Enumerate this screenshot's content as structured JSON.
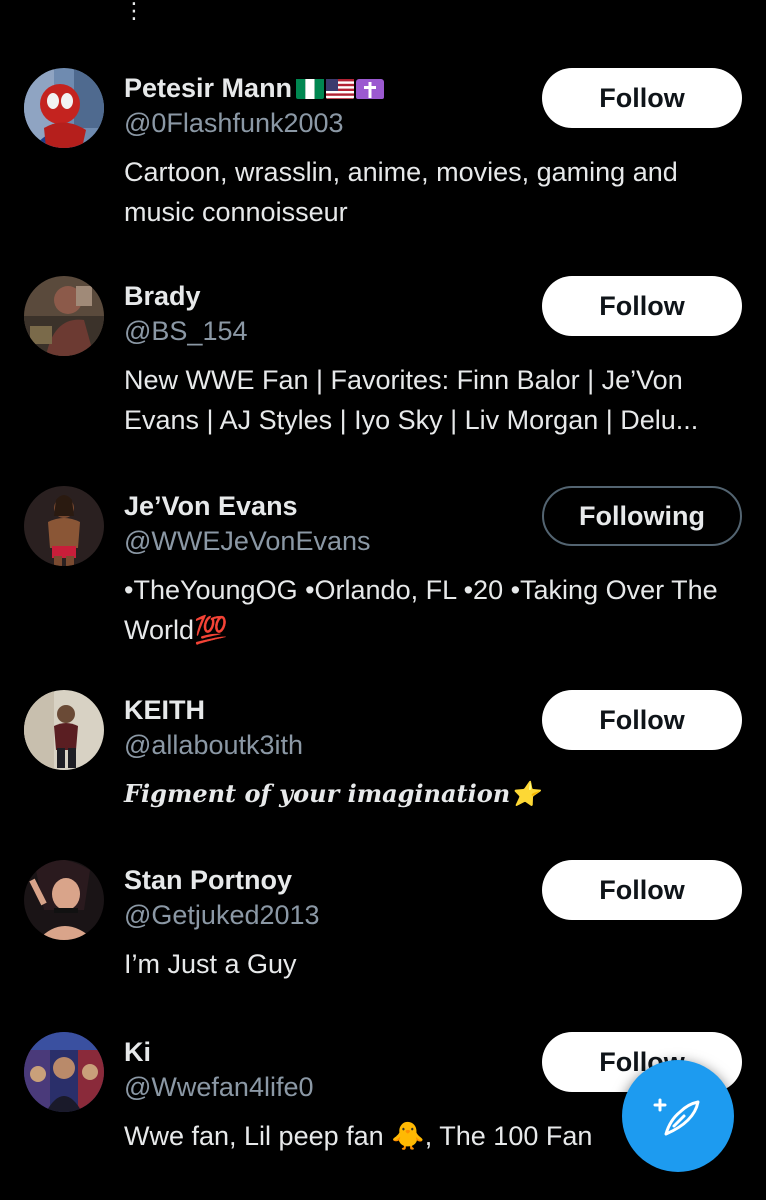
{
  "top_indicator": "⋮",
  "colors": {
    "background": "#000000",
    "primary_text": "#e7e9ea",
    "secondary_text": "#8b98a5",
    "accent": "#1d9bf0",
    "follow_bg": "#ffffff"
  },
  "users": [
    {
      "name": "Petesir Mann",
      "badges": [
        "🇳🇬",
        "🇺🇸",
        "✝️"
      ],
      "handle": "@0Flashfunk2003",
      "bio": "Cartoon, wrasslin, anime, movies, gaming and music connoisseur",
      "button": "Follow"
    },
    {
      "name": "Brady",
      "handle": "@BS_154",
      "bio": "New WWE Fan | Favorites: Finn Balor | Je’Von Evans | AJ Styles | Iyo Sky | Liv Morgan | Delu...",
      "button": "Follow"
    },
    {
      "name": "Je’Von Evans",
      "handle": "@WWEJeVonEvans",
      "bio": "•TheYoungOG •Orlando, FL •20 •Taking Over The World💯",
      "button": "Following"
    },
    {
      "name": "KEITH",
      "handle": "@allaboutk3ith",
      "bio": "Figment of your imagination⭐",
      "button": "Follow"
    },
    {
      "name": "Stan Portnoy",
      "handle": "@Getjuked2013",
      "bio": "I’m Just a Guy",
      "button": "Follow"
    },
    {
      "name": "Ki",
      "handle": "@Wwefan4life0",
      "bio": "Wwe fan, Lil peep fan 🐥, The 100 Fan",
      "button": "Follow"
    }
  ],
  "fab": {
    "icon": "compose-post-icon"
  }
}
